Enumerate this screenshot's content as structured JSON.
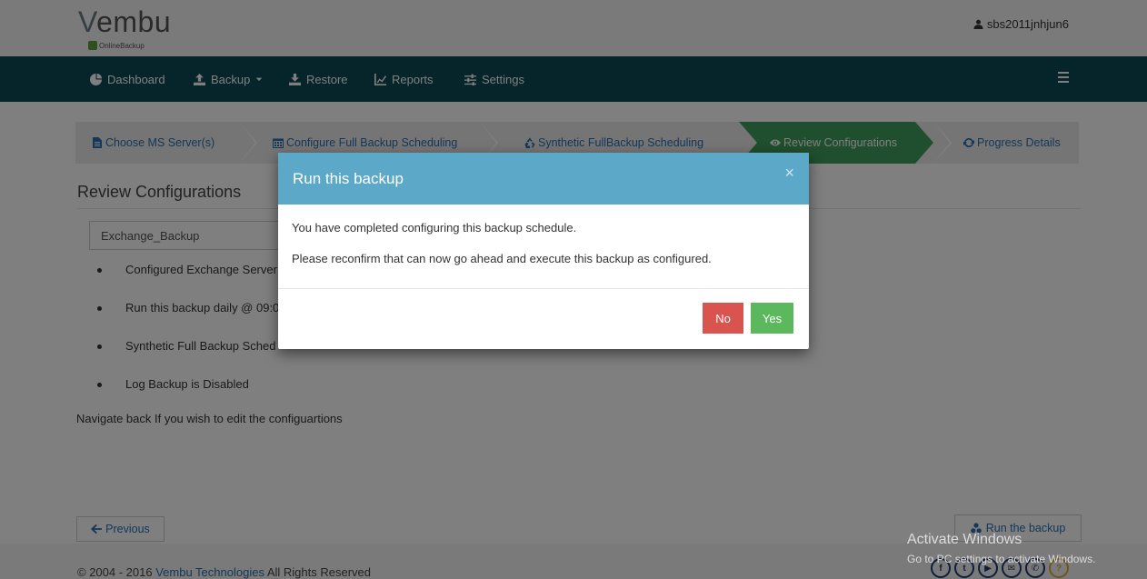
{
  "header": {
    "logo_word": "embu",
    "logo_letter": "V",
    "logo_sub": "OnlineBackup",
    "username": "sbs2011jnhjun6"
  },
  "nav": {
    "items": [
      {
        "label": "Dashboard",
        "icon": "dashboard-icon"
      },
      {
        "label": "Backup",
        "icon": "upload-icon"
      },
      {
        "label": "Restore",
        "icon": "download-icon"
      },
      {
        "label": "Reports",
        "icon": "line-chart-icon"
      },
      {
        "label": "Settings",
        "icon": "sliders-icon"
      }
    ]
  },
  "wizard": {
    "steps": [
      {
        "label": "Choose MS Server(s)",
        "icon": "file-icon"
      },
      {
        "label": "Configure Full Backup Scheduling",
        "icon": "calendar-icon"
      },
      {
        "label": "Synthetic FullBackup Scheduling",
        "icon": "recycle-icon"
      },
      {
        "label": "Review Configurations",
        "icon": "eye-icon"
      },
      {
        "label": "Progress Details",
        "icon": "refresh-icon"
      }
    ],
    "active_index": 3
  },
  "main": {
    "title": "Review Configurations",
    "backup_name": "Exchange_Backup",
    "bullets": [
      "Configured Exchange Server",
      "Run this backup daily @ 09:0",
      "Synthetic Full Backup Sched",
      "Log Backup is Disabled"
    ],
    "navigate_note": "Navigate back If you wish to edit the configuartions",
    "previous_label": "Previous",
    "run_label": "Run the backup"
  },
  "footer": {
    "copyright_prefix": "© 2004 - 2016 ",
    "company": "Vembu Technologies",
    "copyright_suffix": " All Rights Reserved",
    "socials": [
      "facebook-icon",
      "twitter-icon",
      "youtube-icon",
      "mail-icon",
      "phone-icon",
      "help-icon"
    ]
  },
  "watermark": {
    "line1": "Activate Windows",
    "line2": "Go to PC settings to activate Windows."
  },
  "modal": {
    "title": "Run this backup",
    "close": "×",
    "line1": "You have completed configuring this backup schedule.",
    "line2": "Please reconfirm that can now go ahead and execute this backup as configured.",
    "no_label": "No",
    "yes_label": "Yes"
  },
  "colors": {
    "navbar": "#0d4a57",
    "active_step": "#3f9e5d",
    "modal_header": "#5ba8c8",
    "no_button": "#d9534f",
    "yes_button": "#5cb85c",
    "link": "#2a6fb0"
  }
}
